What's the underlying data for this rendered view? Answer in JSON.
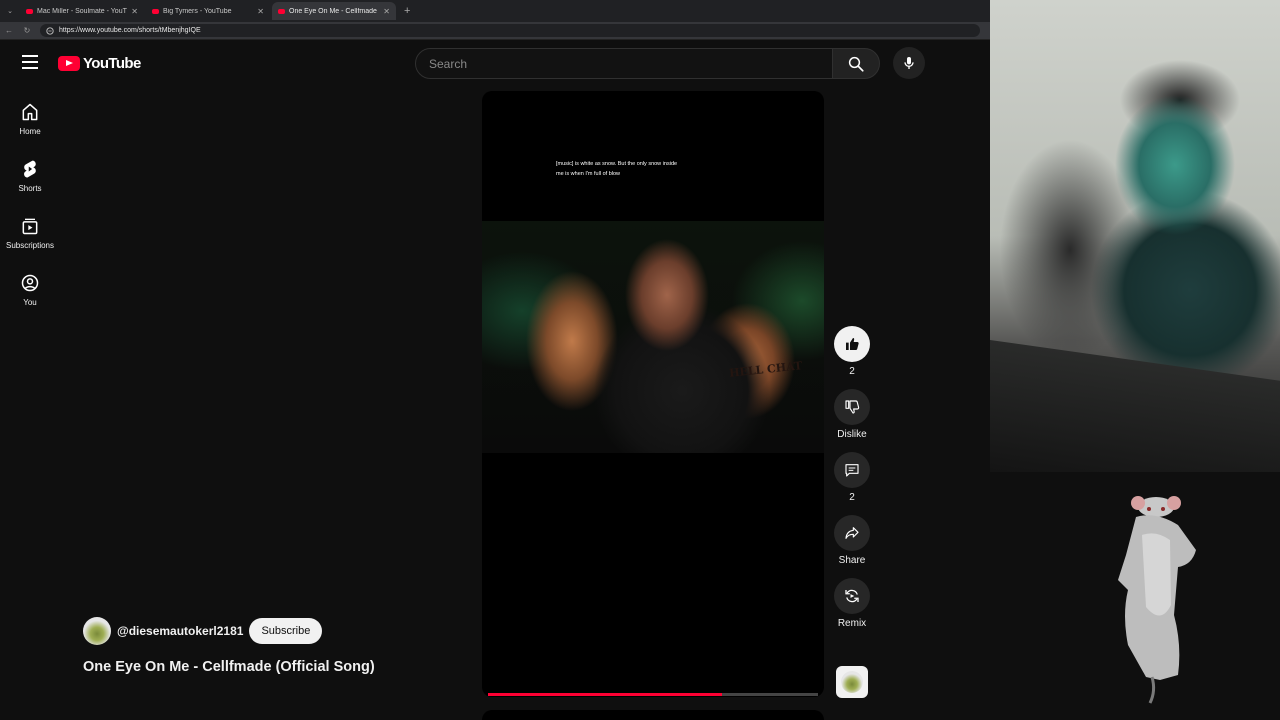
{
  "browser": {
    "tabs": [
      {
        "title": "Mac Miller - Soulmate - YouTube",
        "active": false
      },
      {
        "title": "Big Tymers - YouTube",
        "active": false
      },
      {
        "title": "One Eye On Me - Cellfmade",
        "active": true
      }
    ],
    "new_tab": "+",
    "url": "https://www.youtube.com/shorts/tMbenjhgIQE"
  },
  "header": {
    "logo_text": "YouTube",
    "search_placeholder": "Search"
  },
  "sidebar": {
    "items": [
      {
        "label": "Home",
        "icon": "home-icon"
      },
      {
        "label": "Shorts",
        "icon": "shorts-icon"
      },
      {
        "label": "Subscriptions",
        "icon": "subscriptions-icon"
      },
      {
        "label": "You",
        "icon": "user-circle-icon"
      }
    ]
  },
  "video": {
    "caption": "[music] is white as snow. But the only snow inside me is when I'm full of blow",
    "tattoo_text": "HELL CHAT",
    "progress": 0.71
  },
  "actions": {
    "like_count": "2",
    "dislike_label": "Dislike",
    "comment_count": "2",
    "share_label": "Share",
    "remix_label": "Remix"
  },
  "channel": {
    "handle": "@diesemautokerl2181",
    "subscribe_label": "Subscribe"
  },
  "title": "One Eye On Me - Cellfmade (Official Song)",
  "colors": {
    "background": "#0f0f0f",
    "accent": "#ff0033",
    "text": "#f1f1f1"
  }
}
